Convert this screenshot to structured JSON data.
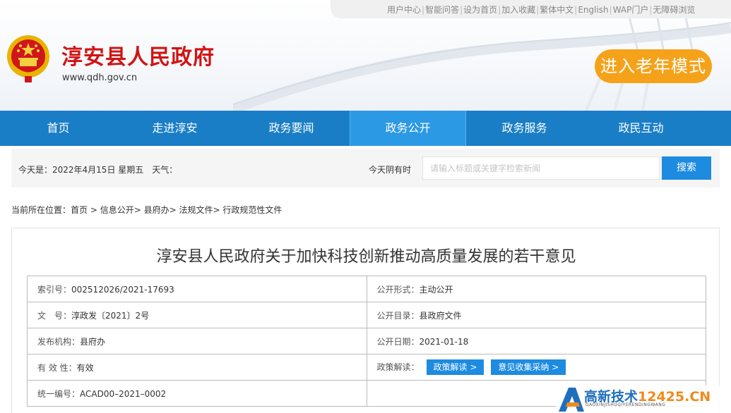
{
  "top_links": [
    "用户中心",
    "智能问答",
    "设为首页",
    "加入收藏",
    "繁体中文",
    "English",
    "WAP门户",
    "无障碍浏览"
  ],
  "site": {
    "title": "淳安县人民政府",
    "url": "www.qdh.gov.cn",
    "elder_mode": "进入老年模式"
  },
  "nav": {
    "items": [
      {
        "label": "首页"
      },
      {
        "label": "走进淳安"
      },
      {
        "label": "政务要闻"
      },
      {
        "label": "政务公开"
      },
      {
        "label": "政务服务"
      },
      {
        "label": "政民互动"
      }
    ],
    "active": "政务公开"
  },
  "infobar": {
    "date": "今天是：2022年4月15日 星期五　天气：",
    "search_label": "今天阴有时",
    "search_placeholder": "请输入标题或关键字检索新闻",
    "search_button": "搜索"
  },
  "breadcrumb": {
    "prefix": "当前所在位置：",
    "items": [
      "首页",
      "信息公开",
      "县府办",
      "法规文件",
      "行政规范性文件"
    ]
  },
  "document": {
    "title": "淳安县人民政府关于加快科技创新推动高质量发展的若干意见",
    "index_label": "索引号：",
    "index_value": "002512026/2021-17693",
    "form_label": "公开形式：",
    "form_value": "主动公开",
    "number_label": "文　号：",
    "number_value": "淳政发〔2021〕2号",
    "catalog_label": "公开目录：",
    "catalog_value": "县政府文件",
    "issuer_label": "发布机构：",
    "issuer_value": "县府办",
    "date_label": "公开日期：",
    "date_value": "2021-01-18",
    "validity_label": "有 效 性：",
    "validity_value": "有效",
    "interpret_label": "政策解读：",
    "interpret_button": "政策解读 >",
    "opinion_button": "意见收集采纳 >",
    "code_label": "统一编号：",
    "code_value": "ACAD00–2021–0002"
  },
  "watermark": {
    "main": "高新技术",
    "domain": "12425.CN",
    "sub": "GAOXINJISHUQIYERENDINGWANG"
  },
  "colors": {
    "nav": "#1a7ec6",
    "nav_active": "#2c99e4",
    "title_red": "#d01414",
    "elder_orange": "#f5a21b",
    "button_blue": "#1d8be0"
  }
}
